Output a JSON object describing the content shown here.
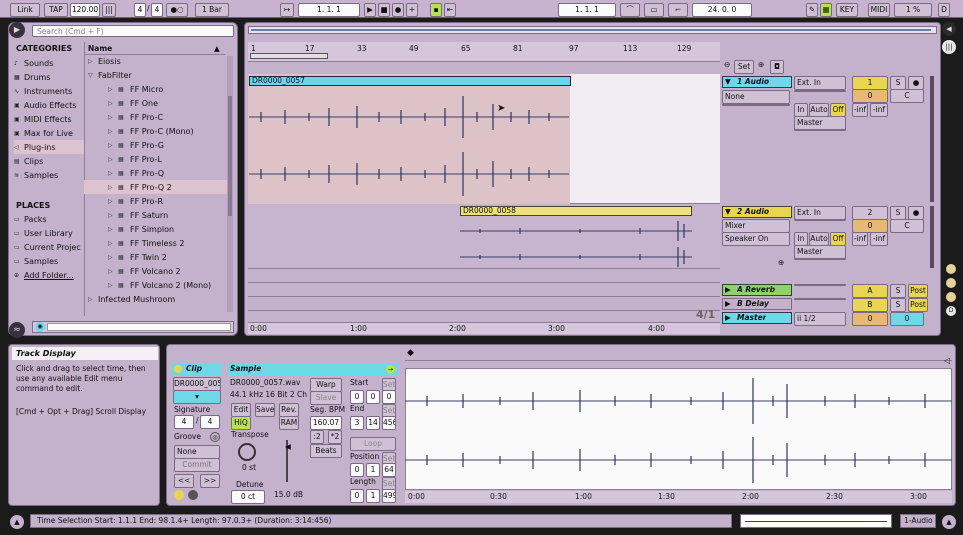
{
  "transport": {
    "link": "Link",
    "tap": "TAP",
    "tempo": "120.00",
    "sig_num": "4",
    "sig_den": "4",
    "quantize": "1 Bar",
    "arr_pos": "1.  1.  1",
    "punch_in": "1.  1.  1",
    "punch_len": "24.  0.  0",
    "key": "KEY",
    "midi": "MIDI",
    "cpu": "1 %",
    "d": "D"
  },
  "browser": {
    "search_placeholder": "Search (Cmd + F)",
    "categories_title": "CATEGORIES",
    "categories": [
      "Sounds",
      "Drums",
      "Instruments",
      "Audio Effects",
      "MIDI Effects",
      "Max for Live",
      "Plug-ins",
      "Clips",
      "Samples"
    ],
    "places_title": "PLACES",
    "places": [
      "Packs",
      "User Library",
      "Current Projec",
      "Samples",
      "Add Folder..."
    ],
    "name_header": "Name",
    "items": [
      "Eiosis",
      "FabFilter",
      "FF Micro",
      "FF One",
      "FF Pro-C",
      "FF Pro-C (Mono)",
      "FF Pro-G",
      "FF Pro-L",
      "FF Pro-Q",
      "FF Pro-Q 2",
      "FF Pro-R",
      "FF Saturn",
      "FF Simplon",
      "FF Timeless 2",
      "FF Twin 2",
      "FF Volcano 2",
      "FF Volcano 2 (Mono)",
      "Infected Mushroom"
    ]
  },
  "ruler": {
    "bars": [
      "1",
      "17",
      "33",
      "49",
      "65",
      "81",
      "97",
      "113",
      "129"
    ],
    "times": [
      "0:00",
      "1:00",
      "2:00",
      "3:00",
      "4:00"
    ],
    "signature": "4/1"
  },
  "clips": {
    "clip1": "DR0000_0057",
    "clip2": "DR0000_0058"
  },
  "tracks": {
    "set": "Set",
    "t1_name": "1 Audio",
    "t2_name": "2 Audio",
    "ret_a": "A Reverb",
    "ret_b": "B Delay",
    "master": "Master",
    "input_none": "None",
    "ext_in": "Ext. In",
    "mixer": "Mixer",
    "spk_on": "Speaker On",
    "in": "In",
    "auto": "Auto",
    "off": "Off",
    "master_out": "Master",
    "one_two": "ii 1/2",
    "num1": "1",
    "num2": "2",
    "zero": "0",
    "c": "C",
    "s": "S",
    "inf": "-inf",
    "a": "A",
    "b": "B",
    "post": "Post"
  },
  "info": {
    "title": "Track Display",
    "body": "Click and drag to select time, then use any available Edit menu command to edit.",
    "shortcut": "[Cmd + Opt + Drag] Scroll Display"
  },
  "clipview": {
    "clip_title": "Clip",
    "clip_name": "DR0000_005",
    "signature": "Signature",
    "sig_num": "4",
    "sig_den": "4",
    "groove": "Groove",
    "groove_val": "None",
    "commit": "Commit",
    "sample_title": "Sample",
    "file": "DR0000_0057.wav",
    "format": "44.1 kHz 16 Bit 2 Ch",
    "edit": "Edit",
    "save": "Save",
    "rev": "Rev.",
    "hiq": "HiQ",
    "ram": "RAM",
    "transpose": "Transpose",
    "transpose_val": "0 st",
    "detune": "Detune",
    "detune_val": "0 ct",
    "gain": "15.0 dB",
    "warp": "Warp",
    "slave": "Slave",
    "seg_bpm": "Seg. BPM",
    "bpm": "160.07",
    "half": ":2",
    "dbl": "*2",
    "mode": "Beats",
    "start": "Start",
    "end": "End",
    "loop": "Loop",
    "position": "Position",
    "length": "Length",
    "set": "Set",
    "start_v": [
      "0",
      "0",
      "0"
    ],
    "end_v": [
      "3",
      "14",
      "456"
    ],
    "pos_v": [
      "0",
      "1",
      "64"
    ],
    "len_v": [
      "0",
      "1",
      "499"
    ],
    "times": [
      "0:00",
      "0:30",
      "1:00",
      "1:30",
      "2:00",
      "2:30",
      "3:00"
    ]
  },
  "status": {
    "text": "Time Selection   Start: 1.1.1    End: 98.1.4+    Length: 97.0.3+ (Duration: 3:14:456)",
    "track": "1-Audio"
  },
  "colors": {
    "bg": "#c4b1cc",
    "clip1": "#67d6e8",
    "clip2": "#efe27a",
    "track1_bg": "#ddc2c8",
    "active_track": "#6fd8e8",
    "return_green": "#8ed26b",
    "master_teal": "#6fd8e8",
    "yellow_sel": "#e8d550",
    "accent_green": "#b8e255"
  }
}
